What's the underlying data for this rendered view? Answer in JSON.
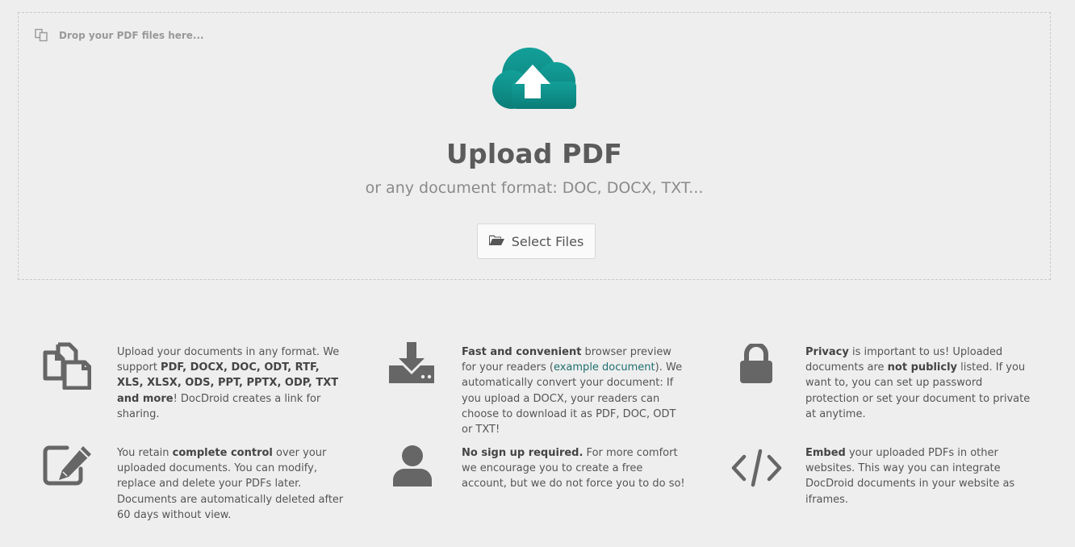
{
  "dropzone": {
    "hint": "Drop your PDF files here...",
    "title": "Upload PDF",
    "subtitle": "or any document format: DOC, DOCX, TXT...",
    "select_button": "Select Files",
    "cloud_color": "#0f8e89"
  },
  "features": {
    "formats": {
      "p1": "Upload your documents in any format. We support ",
      "b1": "PDF, DOCX, DOC, ODT, RTF, XLS, XLSX, ODS, PPT, PPTX, ODP, TXT and more",
      "p2": "! DocDroid creates a link for sharing."
    },
    "preview": {
      "b1": "Fast and convenient",
      "p1": " browser preview for your readers (",
      "link": "example document",
      "p2": "). We automatically convert your document: If you upload a DOCX, your readers can choose to download it as PDF, DOC, ODT or TXT!"
    },
    "privacy": {
      "b1": "Privacy",
      "p1": " is important to us! Uploaded documents are ",
      "b2": "not publicly",
      "p2": " listed. If you want to, you can set up password protection or set your document to private at anytime."
    },
    "control": {
      "p1": "You retain ",
      "b1": "complete control",
      "p2": " over your uploaded documents. You can modify, replace and delete your PDFs later. Documents are automatically deleted after 60 days without view."
    },
    "signup": {
      "b1": "No sign up required.",
      "p1": " For more comfort we encourage you to create a free account, but we do not force you to do so!"
    },
    "embed": {
      "b1": "Embed",
      "p1": " your uploaded PDFs in other websites. This way you can integrate DocDroid documents in your website as iframes."
    }
  },
  "icons": {
    "hint": "copy-files-icon",
    "cloud": "cloud-upload-icon",
    "folder": "folder-open-icon",
    "formats": "files-icon",
    "preview": "download-icon",
    "privacy": "lock-icon",
    "control": "edit-icon",
    "signup": "user-icon",
    "embed": "code-icon"
  },
  "colors": {
    "icon_gray": "#666666",
    "link": "#1f6f6f"
  }
}
